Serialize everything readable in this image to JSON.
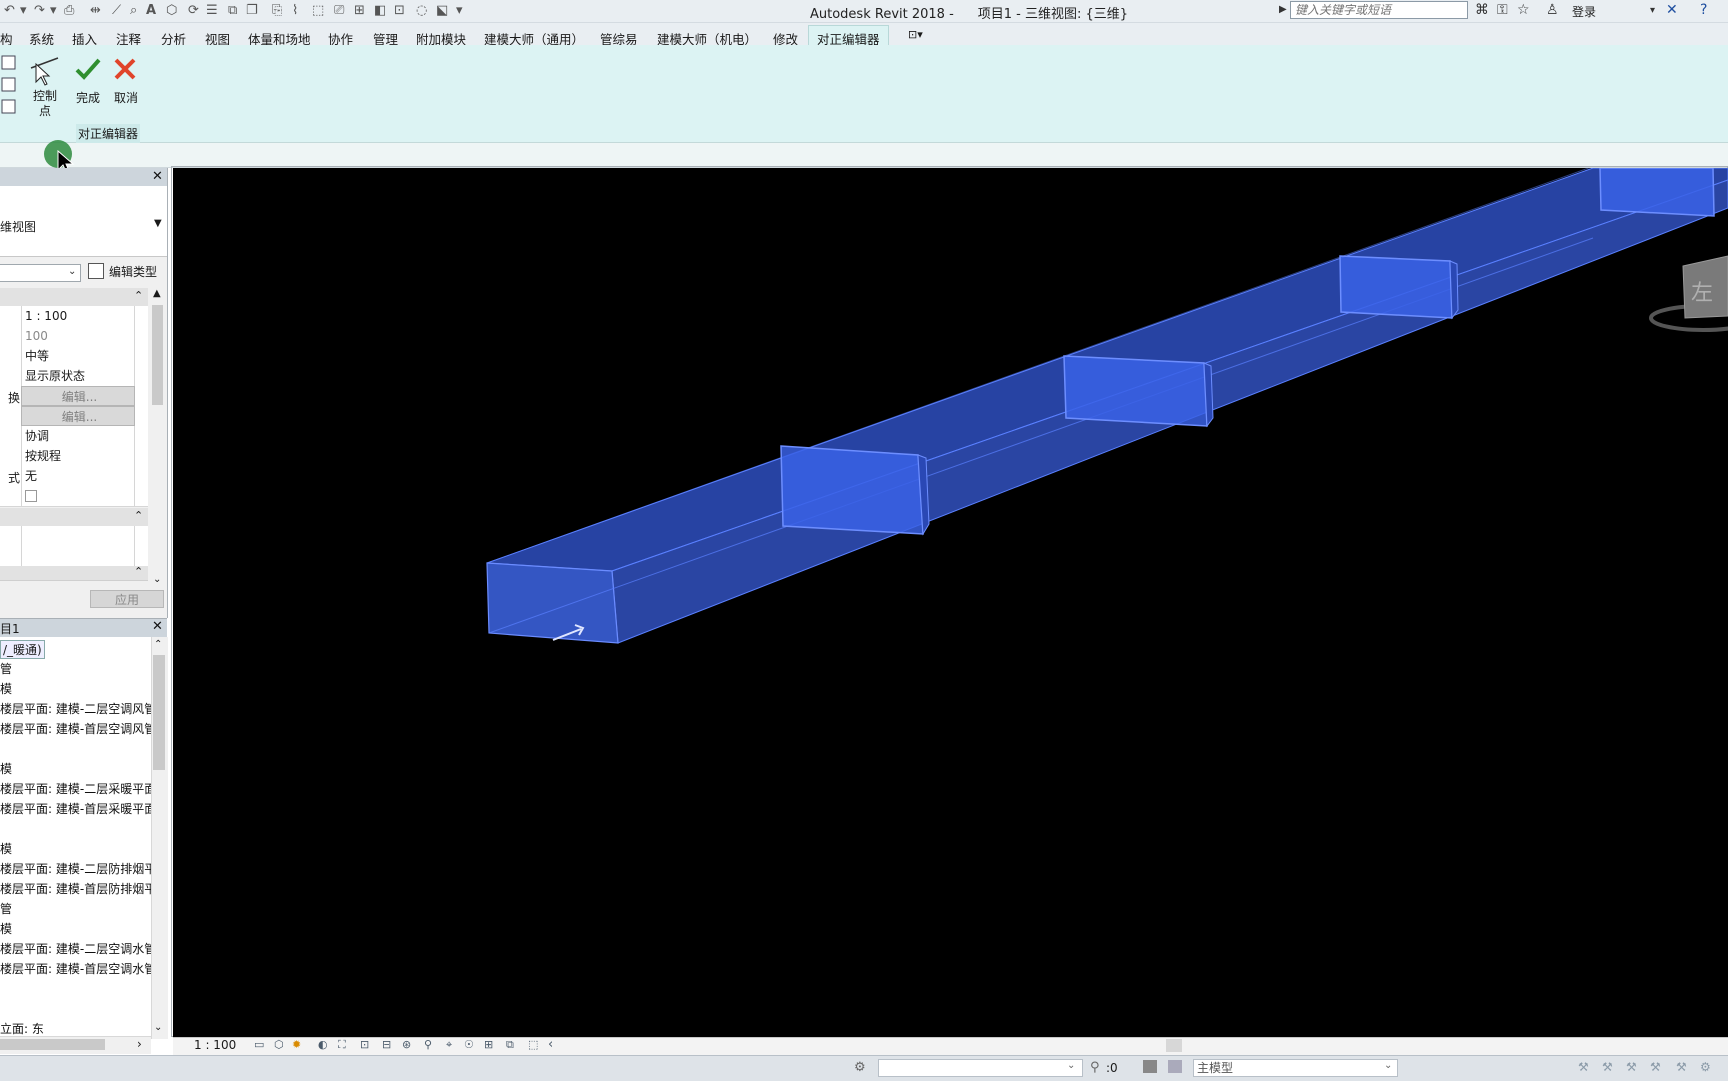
{
  "window": {
    "app_title": "Autodesk Revit 2018 -",
    "doc_title": "项目1 - 三维视图: {三维}",
    "search_placeholder": "键入关键字或短语",
    "login_label": "登录"
  },
  "ribbon": {
    "tabs": [
      "构",
      "系统",
      "插入",
      "注释",
      "分析",
      "视图",
      "体量和场地",
      "协作",
      "管理",
      "附加模块",
      "建模大师（通用）",
      "管综易",
      "建模大师（机电）",
      "修改",
      "对正编辑器"
    ],
    "active_tab": "对正编辑器",
    "buttons": {
      "control_point": "控制\n点",
      "control_point_line1": "控制",
      "control_point_line2": "点",
      "finish": "完成",
      "cancel": "取消"
    },
    "panel_title": "对正编辑器"
  },
  "properties": {
    "type_name": "维视图",
    "edit_type_label": "编辑类型",
    "rows": [
      {
        "name": "",
        "value": "1 : 100",
        "style": "normal"
      },
      {
        "name": "",
        "value": "100",
        "style": "dim"
      },
      {
        "name": "",
        "value": "中等",
        "style": "normal"
      },
      {
        "name": "",
        "value": "显示原状态",
        "style": "normal"
      },
      {
        "name": "换",
        "value": "编辑...",
        "style": "button"
      },
      {
        "name": "",
        "value": "编辑...",
        "style": "button"
      },
      {
        "name": "",
        "value": "协调",
        "style": "normal"
      },
      {
        "name": "",
        "value": "按规程",
        "style": "normal"
      },
      {
        "name": "式",
        "value": "无",
        "style": "normal"
      },
      {
        "name": "",
        "value": "",
        "style": "checkbox"
      }
    ],
    "apply_label": "应用"
  },
  "project_browser": {
    "title": "目1",
    "root": "/_暖通)",
    "items": [
      "管",
      "模",
      "楼层平面: 建模-二层空调风管",
      "楼层平面: 建模-首层空调风管",
      "",
      "模",
      "楼层平面: 建模-二层采暖平面",
      "楼层平面: 建模-首层采暖平面",
      "",
      "模",
      "楼层平面: 建模-二层防排烟平",
      "楼层平面: 建模-首层防排烟平",
      "管",
      "模",
      "楼层平面: 建模-二层空调水管",
      "楼层平面: 建模-首层空调水管"
    ],
    "bottom_item": "立面: 东"
  },
  "viewport": {
    "view_cube_face": "左",
    "background": "#000000",
    "duct_color": "#3a5fd8"
  },
  "view_control": {
    "scale": "1 : 100"
  },
  "status": {
    "selection_count": ":0",
    "active_model": "主模型"
  }
}
